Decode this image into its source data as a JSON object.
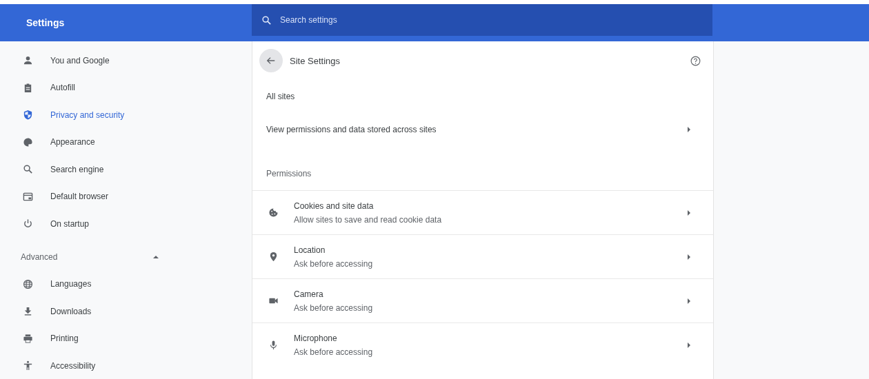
{
  "header": {
    "title": "Settings",
    "search": {
      "placeholder": "Search settings"
    }
  },
  "sidebar": {
    "items": [
      {
        "label": "You and Google",
        "selected": false
      },
      {
        "label": "Autofill",
        "selected": false
      },
      {
        "label": "Privacy and security",
        "selected": true
      },
      {
        "label": "Appearance",
        "selected": false
      },
      {
        "label": "Search engine",
        "selected": false
      },
      {
        "label": "Default browser",
        "selected": false
      },
      {
        "label": "On startup",
        "selected": false
      }
    ],
    "advanced": {
      "label": "Advanced",
      "expanded": true,
      "items": [
        {
          "label": "Languages",
          "selected": false
        },
        {
          "label": "Downloads",
          "selected": false
        },
        {
          "label": "Printing",
          "selected": false
        },
        {
          "label": "Accessibility",
          "selected": false
        }
      ]
    }
  },
  "page": {
    "title": "Site Settings",
    "all_sites": {
      "heading": "All sites",
      "link": "View permissions and data stored across sites"
    },
    "permissions": {
      "heading": "Permissions",
      "items": [
        {
          "title": "Cookies and site data",
          "subtitle": "Allow sites to save and read cookie data"
        },
        {
          "title": "Location",
          "subtitle": "Ask before accessing"
        },
        {
          "title": "Camera",
          "subtitle": "Ask before accessing"
        },
        {
          "title": "Microphone",
          "subtitle": "Ask before accessing"
        }
      ]
    }
  }
}
